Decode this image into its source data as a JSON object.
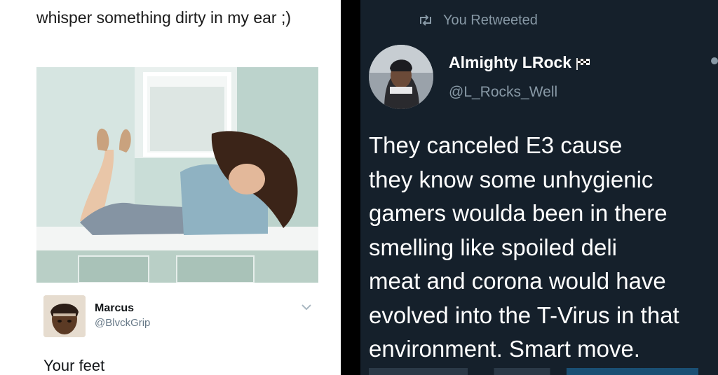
{
  "left_tweet": {
    "text": "whisper something dirty in my ear ;)",
    "reply": {
      "name": "Marcus",
      "handle": "@BlvckGrip",
      "text": "Your feet"
    }
  },
  "right_tweet": {
    "retweet_label": "You Retweeted",
    "name": "Almighty LRock",
    "handle": "@L_Rocks_Well",
    "text": "They canceled E3 cause\nthey know some unhygienic\ngamers woulda been in there\nsmelling like spoiled deli\nmeat and corona would have\nevolved into the T-Virus in that\nenvironment. Smart move."
  },
  "icons": [
    "retweet-icon",
    "checkered-flag-icon",
    "chevron-down-icon"
  ],
  "colors": {
    "left_background": "#ffffff",
    "right_background": "#15202b",
    "secondary_text": "#8899a6"
  }
}
